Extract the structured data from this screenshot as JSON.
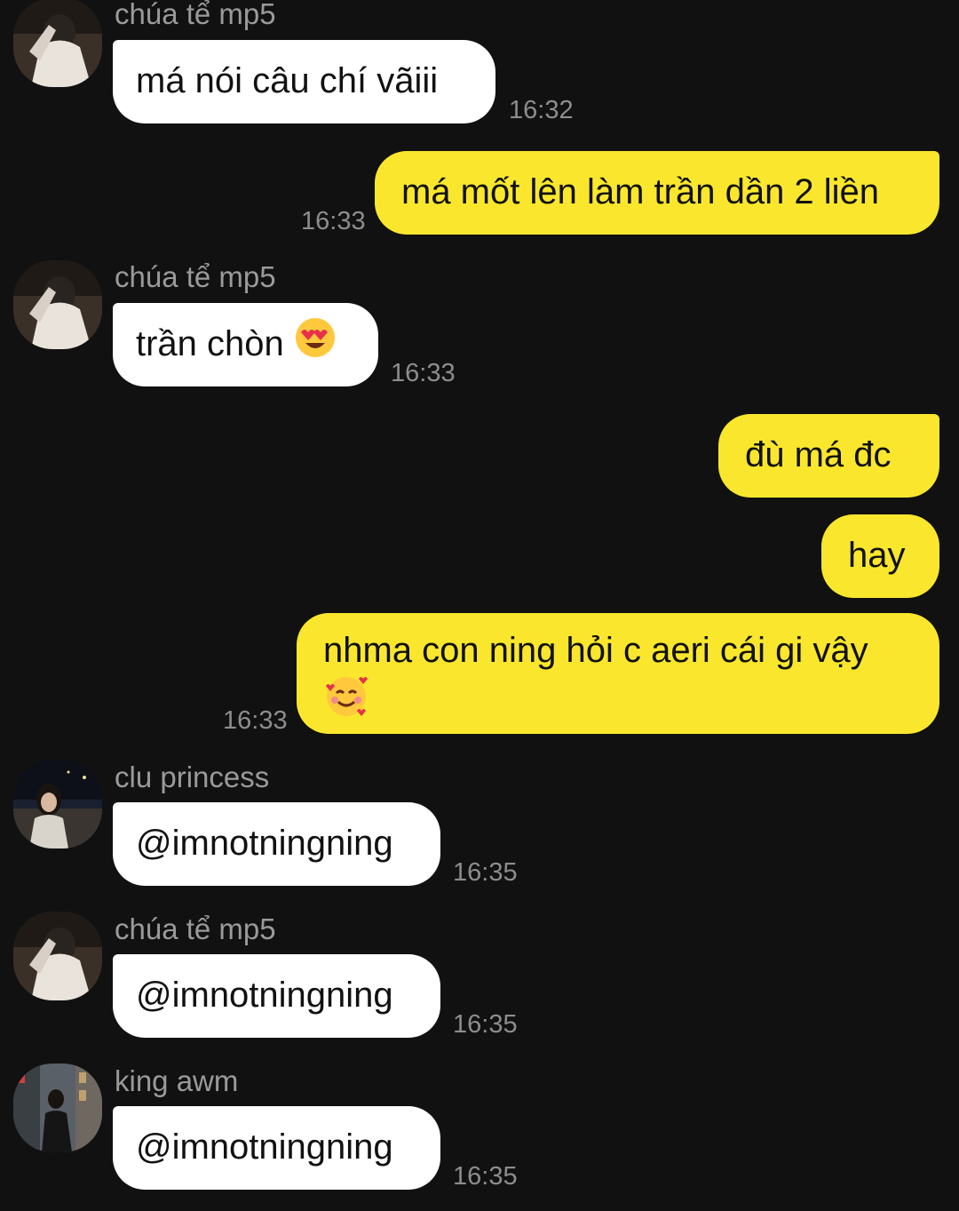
{
  "messages": [
    {
      "type": "in",
      "sender": "chúa tể mp5",
      "text": "má nói câu chí vãiii",
      "time": "16:32"
    },
    {
      "type": "out",
      "text": "má mốt lên làm trần dần 2 liền",
      "time": "16:33"
    },
    {
      "type": "in",
      "sender": "chúa tể mp5",
      "text": "trần chòn",
      "emoji": "heart-eyes-emoji",
      "time": "16:33"
    },
    {
      "type": "out",
      "text": "đù má đc"
    },
    {
      "type": "out",
      "text": "hay"
    },
    {
      "type": "out",
      "text": "nhma con ning hỏi c aeri cái gi vậy",
      "emoji": "smiling-hearts-emoji",
      "time": "16:33"
    },
    {
      "type": "in",
      "sender": "clu princess",
      "text": "@imnotningning",
      "time": "16:35"
    },
    {
      "type": "in",
      "sender": "chúa tể mp5",
      "text": "@imnotningning",
      "time": "16:35"
    },
    {
      "type": "in",
      "sender": "king awm",
      "text": "@imnotningning",
      "time": "16:35"
    }
  ],
  "colors": {
    "background": "#111111",
    "incoming_bubble": "#ffffff",
    "outgoing_bubble": "#fae72d",
    "sender_name": "#9a9a9a",
    "timestamp": "#8d8d8d"
  }
}
